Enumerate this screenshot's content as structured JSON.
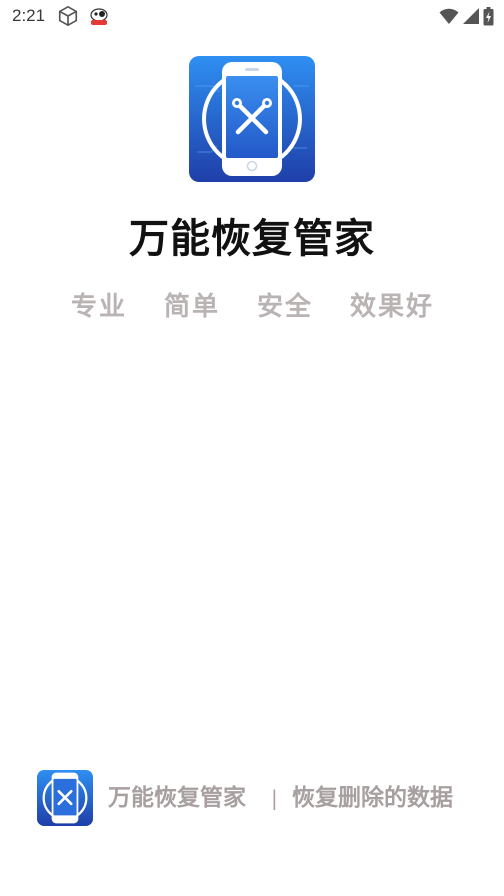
{
  "status_bar": {
    "time": "2:21",
    "icons": [
      "cube-icon",
      "app-notification-icon",
      "wifi-icon",
      "cellular-signal-icon",
      "battery-icon"
    ]
  },
  "splash": {
    "title": "万能恢复管家",
    "slogans": [
      "专业",
      "简单",
      "安全",
      "效果好"
    ]
  },
  "footer": {
    "app_name": "万能恢复管家",
    "divider": "|",
    "tagline": "恢复删除的数据"
  },
  "colors": {
    "logo_gradient_start": "#2f8ff2",
    "logo_gradient_end": "#1f3fa8",
    "title": "#111111",
    "slogan": "#b9b3b3",
    "footer_text": "#a8a0a0"
  }
}
